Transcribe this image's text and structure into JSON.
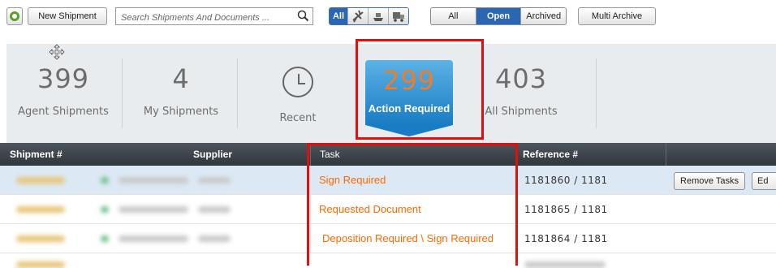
{
  "toolbar": {
    "new_shipment": "New Shipment",
    "search_placeholder": "Search Shipments And Documents ...",
    "mode_all": "All",
    "mode_icons": [
      "plane-icon",
      "ship-icon",
      "truck-icon"
    ],
    "status_filters": [
      "All",
      "Open",
      "Archived"
    ],
    "status_selected": "Open",
    "multi_archive": "Multi Archive"
  },
  "stats": [
    {
      "value": "399",
      "label": "Agent Shipments"
    },
    {
      "value": "4",
      "label": "My Shipments"
    },
    {
      "value": "",
      "label": "Recent"
    },
    {
      "value": "299",
      "label": "Action Required"
    },
    {
      "value": "403",
      "label": "All Shipments"
    }
  ],
  "table": {
    "columns": [
      "Shipment #",
      "Supplier",
      "Task",
      "Reference #"
    ],
    "rows": [
      {
        "task": "Sign Required",
        "reference": "1181860 / 1181",
        "selected": true
      },
      {
        "task": "Requested Document",
        "reference": "1181865 / 1181",
        "selected": false
      },
      {
        "task": "Deposition Required \\ Sign Required",
        "reference": "1181864 / 1181",
        "selected": false
      }
    ],
    "row_actions": {
      "remove_tasks": "Remove Tasks",
      "edit": "Ed"
    }
  },
  "colors": {
    "accent": "#2a66b3",
    "task_text": "#ff6a00",
    "highlight_box": "#e01010",
    "action_tile": "#1a7cc4"
  }
}
